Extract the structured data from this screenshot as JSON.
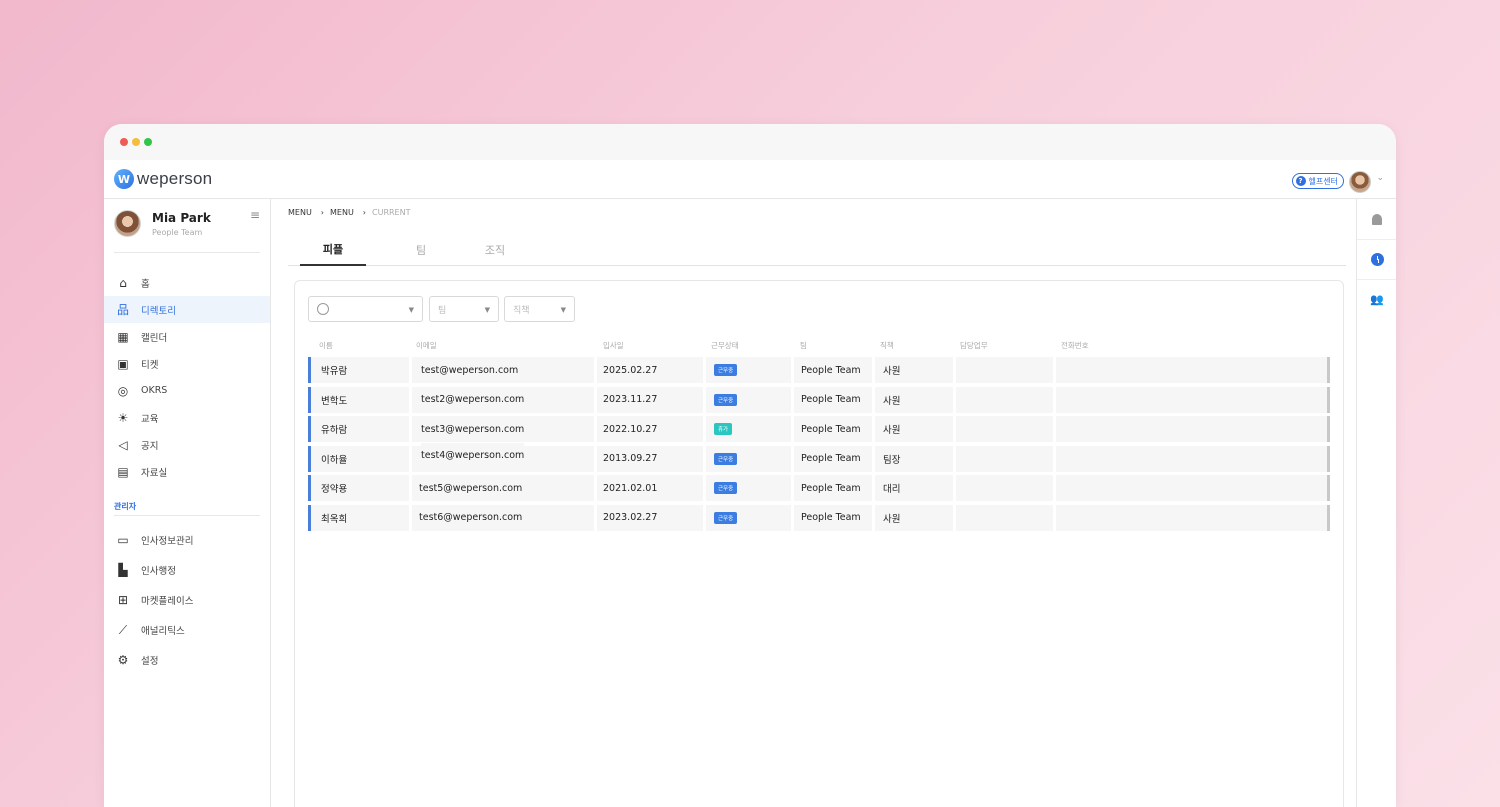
{
  "app": {
    "logo_text": "weperson",
    "help_label": "헬프센터"
  },
  "colors": {
    "accent": "#2f6fe0",
    "active_badge": "#3b7de0",
    "leave_badge": "#2bc6c0",
    "row_marker": "#4a7fd9"
  },
  "profile": {
    "name": "Mia Park",
    "team": "People Team"
  },
  "sidebar": {
    "items": [
      {
        "label": "홈",
        "icon": "home-icon"
      },
      {
        "label": "디렉토리",
        "icon": "org-chart-icon"
      },
      {
        "label": "캘린더",
        "icon": "calendar-icon"
      },
      {
        "label": "티켓",
        "icon": "ticket-icon"
      },
      {
        "label": "OKRS",
        "icon": "target-icon"
      },
      {
        "label": "교육",
        "icon": "lightbulb-icon"
      },
      {
        "label": "공지",
        "icon": "megaphone-icon"
      },
      {
        "label": "자료실",
        "icon": "archive-icon"
      }
    ],
    "admin_label": "관리자",
    "admin_items": [
      {
        "label": "인사정보관리",
        "icon": "id-card-folder-icon"
      },
      {
        "label": "인사행정",
        "icon": "document-icon"
      },
      {
        "label": "마켓플레이스",
        "icon": "gift-icon"
      },
      {
        "label": "애널리틱스",
        "icon": "line-chart-icon"
      },
      {
        "label": "설정",
        "icon": "gear-icon"
      }
    ]
  },
  "breadcrumb": {
    "item1": "MENU",
    "item2": "MENU",
    "current": "CURRENT"
  },
  "tabs": [
    {
      "label": "피플"
    },
    {
      "label": "팀"
    },
    {
      "label": "조직"
    }
  ],
  "filters": {
    "name_placeholder": "",
    "team_placeholder": "팀",
    "position_placeholder": "직책"
  },
  "table": {
    "headers": [
      "이름",
      "이메일",
      "입사일",
      "근무상태",
      "팀",
      "직책",
      "담당업무",
      "전화번호"
    ],
    "rows": [
      {
        "name": "박유람",
        "email": "test@weperson.com",
        "joined": "2025.02.27",
        "status": "근무중",
        "team": "People Team",
        "position": "사원"
      },
      {
        "name": "변학도",
        "email": "test2@weperson.com",
        "joined": "2023.11.27",
        "status": "근무중",
        "team": "People Team",
        "position": "사원"
      },
      {
        "name": "유하람",
        "email": "test3@weperson.com",
        "joined": "2022.10.27",
        "status": "휴가",
        "team": "People Team",
        "position": "사원"
      },
      {
        "name": "이하율",
        "email": "test4@weperson.com",
        "joined": "2013.09.27",
        "status": "근무중",
        "team": "People Team",
        "position": "팀장"
      },
      {
        "name": "정약용",
        "email": "test5@weperson.com",
        "joined": "2021.02.01",
        "status": "근무중",
        "team": "People Team",
        "position": "대리"
      },
      {
        "name": "최옥희",
        "email": "test6@weperson.com",
        "joined": "2023.02.27",
        "status": "근무중",
        "team": "People Team",
        "position": "사원"
      }
    ]
  }
}
